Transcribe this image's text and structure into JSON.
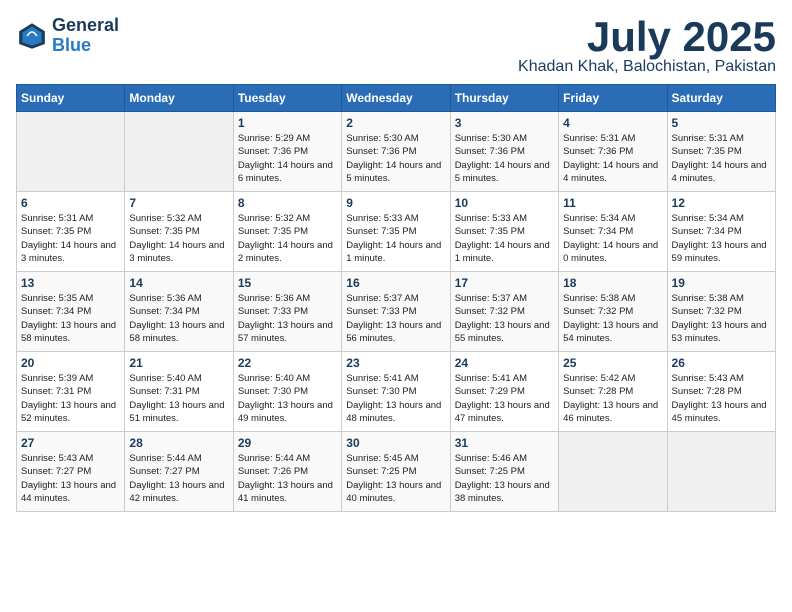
{
  "header": {
    "logo_line1": "General",
    "logo_line2": "Blue",
    "month_year": "July 2025",
    "location": "Khadan Khak, Balochistan, Pakistan"
  },
  "weekdays": [
    "Sunday",
    "Monday",
    "Tuesday",
    "Wednesday",
    "Thursday",
    "Friday",
    "Saturday"
  ],
  "weeks": [
    [
      {
        "day": "",
        "info": ""
      },
      {
        "day": "",
        "info": ""
      },
      {
        "day": "1",
        "info": "Sunrise: 5:29 AM\nSunset: 7:36 PM\nDaylight: 14 hours and 6 minutes."
      },
      {
        "day": "2",
        "info": "Sunrise: 5:30 AM\nSunset: 7:36 PM\nDaylight: 14 hours and 5 minutes."
      },
      {
        "day": "3",
        "info": "Sunrise: 5:30 AM\nSunset: 7:36 PM\nDaylight: 14 hours and 5 minutes."
      },
      {
        "day": "4",
        "info": "Sunrise: 5:31 AM\nSunset: 7:36 PM\nDaylight: 14 hours and 4 minutes."
      },
      {
        "day": "5",
        "info": "Sunrise: 5:31 AM\nSunset: 7:35 PM\nDaylight: 14 hours and 4 minutes."
      }
    ],
    [
      {
        "day": "6",
        "info": "Sunrise: 5:31 AM\nSunset: 7:35 PM\nDaylight: 14 hours and 3 minutes."
      },
      {
        "day": "7",
        "info": "Sunrise: 5:32 AM\nSunset: 7:35 PM\nDaylight: 14 hours and 3 minutes."
      },
      {
        "day": "8",
        "info": "Sunrise: 5:32 AM\nSunset: 7:35 PM\nDaylight: 14 hours and 2 minutes."
      },
      {
        "day": "9",
        "info": "Sunrise: 5:33 AM\nSunset: 7:35 PM\nDaylight: 14 hours and 1 minute."
      },
      {
        "day": "10",
        "info": "Sunrise: 5:33 AM\nSunset: 7:35 PM\nDaylight: 14 hours and 1 minute."
      },
      {
        "day": "11",
        "info": "Sunrise: 5:34 AM\nSunset: 7:34 PM\nDaylight: 14 hours and 0 minutes."
      },
      {
        "day": "12",
        "info": "Sunrise: 5:34 AM\nSunset: 7:34 PM\nDaylight: 13 hours and 59 minutes."
      }
    ],
    [
      {
        "day": "13",
        "info": "Sunrise: 5:35 AM\nSunset: 7:34 PM\nDaylight: 13 hours and 58 minutes."
      },
      {
        "day": "14",
        "info": "Sunrise: 5:36 AM\nSunset: 7:34 PM\nDaylight: 13 hours and 58 minutes."
      },
      {
        "day": "15",
        "info": "Sunrise: 5:36 AM\nSunset: 7:33 PM\nDaylight: 13 hours and 57 minutes."
      },
      {
        "day": "16",
        "info": "Sunrise: 5:37 AM\nSunset: 7:33 PM\nDaylight: 13 hours and 56 minutes."
      },
      {
        "day": "17",
        "info": "Sunrise: 5:37 AM\nSunset: 7:32 PM\nDaylight: 13 hours and 55 minutes."
      },
      {
        "day": "18",
        "info": "Sunrise: 5:38 AM\nSunset: 7:32 PM\nDaylight: 13 hours and 54 minutes."
      },
      {
        "day": "19",
        "info": "Sunrise: 5:38 AM\nSunset: 7:32 PM\nDaylight: 13 hours and 53 minutes."
      }
    ],
    [
      {
        "day": "20",
        "info": "Sunrise: 5:39 AM\nSunset: 7:31 PM\nDaylight: 13 hours and 52 minutes."
      },
      {
        "day": "21",
        "info": "Sunrise: 5:40 AM\nSunset: 7:31 PM\nDaylight: 13 hours and 51 minutes."
      },
      {
        "day": "22",
        "info": "Sunrise: 5:40 AM\nSunset: 7:30 PM\nDaylight: 13 hours and 49 minutes."
      },
      {
        "day": "23",
        "info": "Sunrise: 5:41 AM\nSunset: 7:30 PM\nDaylight: 13 hours and 48 minutes."
      },
      {
        "day": "24",
        "info": "Sunrise: 5:41 AM\nSunset: 7:29 PM\nDaylight: 13 hours and 47 minutes."
      },
      {
        "day": "25",
        "info": "Sunrise: 5:42 AM\nSunset: 7:28 PM\nDaylight: 13 hours and 46 minutes."
      },
      {
        "day": "26",
        "info": "Sunrise: 5:43 AM\nSunset: 7:28 PM\nDaylight: 13 hours and 45 minutes."
      }
    ],
    [
      {
        "day": "27",
        "info": "Sunrise: 5:43 AM\nSunset: 7:27 PM\nDaylight: 13 hours and 44 minutes."
      },
      {
        "day": "28",
        "info": "Sunrise: 5:44 AM\nSunset: 7:27 PM\nDaylight: 13 hours and 42 minutes."
      },
      {
        "day": "29",
        "info": "Sunrise: 5:44 AM\nSunset: 7:26 PM\nDaylight: 13 hours and 41 minutes."
      },
      {
        "day": "30",
        "info": "Sunrise: 5:45 AM\nSunset: 7:25 PM\nDaylight: 13 hours and 40 minutes."
      },
      {
        "day": "31",
        "info": "Sunrise: 5:46 AM\nSunset: 7:25 PM\nDaylight: 13 hours and 38 minutes."
      },
      {
        "day": "",
        "info": ""
      },
      {
        "day": "",
        "info": ""
      }
    ]
  ]
}
